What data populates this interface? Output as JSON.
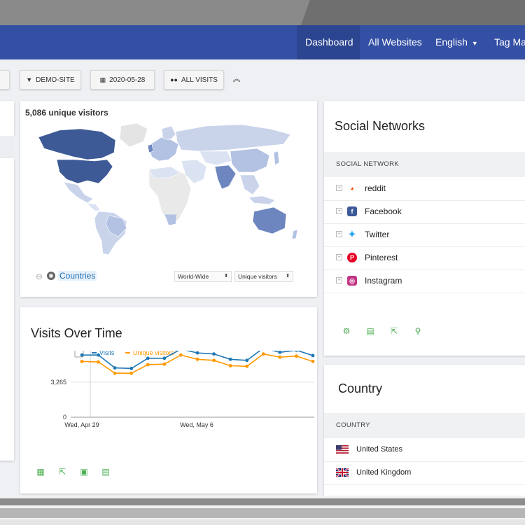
{
  "nav": {
    "dashboard": "Dashboard",
    "all_websites": "All Websites",
    "language": "English",
    "tag_manager": "Tag Mar"
  },
  "toolbar": {
    "site": "DEMO-SITE",
    "date": "2020-05-28",
    "segment": "ALL VISITS"
  },
  "map_widget": {
    "title": "5,086 unique visitors",
    "countries_link": "Countries",
    "scope_select": "World-Wide",
    "metric_select": "Unique visitors"
  },
  "visits_widget": {
    "title": "Visits Over Time"
  },
  "chart_data": {
    "type": "line",
    "title": "",
    "x_ticks": [
      "Wed, Apr 29",
      "Wed, May 6"
    ],
    "y_ticks": [
      "6,530",
      "3,265",
      "0"
    ],
    "ylim": [
      0,
      6530
    ],
    "legend_position": "top-left",
    "grid": true,
    "series": [
      {
        "name": "Visits",
        "color": "#1f77b4",
        "values": [
          5800,
          5800,
          4600,
          4550,
          5500,
          5500,
          6350,
          6000,
          5900,
          5400,
          5300,
          6450,
          6050,
          6250,
          5750
        ]
      },
      {
        "name": "Unique visitors",
        "color": "#ff9800",
        "values": [
          5200,
          5150,
          4100,
          4100,
          4900,
          4950,
          5800,
          5400,
          5300,
          4800,
          4750,
          5900,
          5600,
          5700,
          5200
        ]
      }
    ]
  },
  "social": {
    "title": "Social Networks",
    "column_header": "SOCIAL NETWORK",
    "rows": [
      {
        "label": "reddit",
        "icon": "reddit-icon",
        "color": "#ffffff"
      },
      {
        "label": "Facebook",
        "icon": "facebook-icon",
        "color": "#3b5998"
      },
      {
        "label": "Twitter",
        "icon": "twitter-icon",
        "color": "#1da1f2"
      },
      {
        "label": "Pinterest",
        "icon": "pinterest-icon",
        "color": "#e60023"
      },
      {
        "label": "Instagram",
        "icon": "instagram-icon",
        "color": "#c13584"
      }
    ]
  },
  "country": {
    "title": "Country",
    "column_header": "COUNTRY",
    "rows": [
      {
        "label": "United States",
        "icon": "us-flag-icon"
      },
      {
        "label": "United Kingdom",
        "icon": "uk-flag-icon"
      }
    ]
  },
  "colors": {
    "navbar": "#3450a5",
    "accent_green": "#4caf50",
    "map_dark": "#3d5a96",
    "map_light": "#c9d4eb"
  }
}
